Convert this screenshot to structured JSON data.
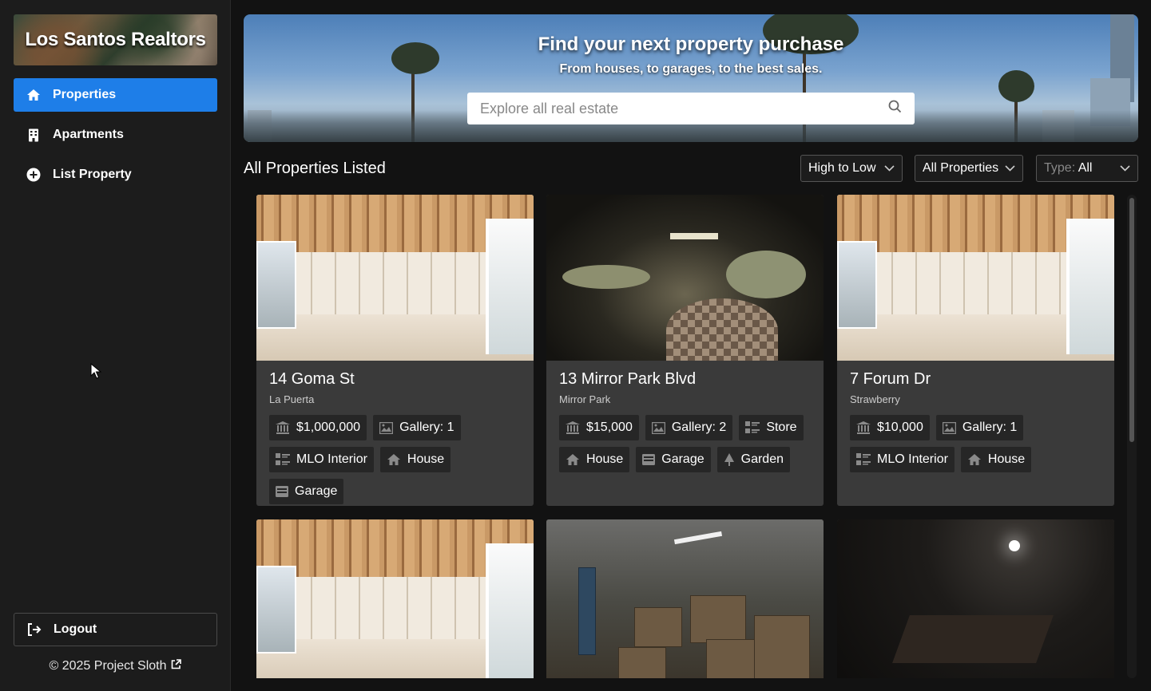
{
  "sidebar": {
    "brand": "Los Santos Realtors",
    "items": [
      {
        "label": "Properties",
        "icon": "home-icon",
        "active": true
      },
      {
        "label": "Apartments",
        "icon": "building-icon",
        "active": false
      },
      {
        "label": "List Property",
        "icon": "plus-circle-icon",
        "active": false
      }
    ],
    "logout_label": "Logout",
    "footer": "© 2025 Project Sloth"
  },
  "hero": {
    "title": "Find your next property purchase",
    "subtitle": "From houses, to garages, to the best sales.",
    "search_placeholder": "Explore all real estate"
  },
  "listing": {
    "section_title": "All Properties Listed",
    "sort_value": "High to Low",
    "filter_value": "All Properties",
    "type_label": "Type:",
    "type_value": "All"
  },
  "cards": [
    {
      "title": "14 Goma St",
      "area": "La Puerta",
      "image": "empty-room",
      "tags": [
        {
          "icon": "bank-icon",
          "label": "$1,000,000"
        },
        {
          "icon": "image-icon",
          "label": "Gallery: 1"
        },
        {
          "icon": "interior-icon",
          "label": "MLO Interior"
        },
        {
          "icon": "house-icon",
          "label": "House"
        },
        {
          "icon": "garage-icon",
          "label": "Garage"
        }
      ]
    },
    {
      "title": "13 Mirror Park Blvd",
      "area": "Mirror Park",
      "image": "dark-room",
      "tags": [
        {
          "icon": "bank-icon",
          "label": "$15,000"
        },
        {
          "icon": "image-icon",
          "label": "Gallery: 2"
        },
        {
          "icon": "interior-icon",
          "label": "Store"
        },
        {
          "icon": "house-icon",
          "label": "House"
        },
        {
          "icon": "garage-icon",
          "label": "Garage"
        },
        {
          "icon": "tree-icon",
          "label": "Garden"
        }
      ]
    },
    {
      "title": "7 Forum Dr",
      "area": "Strawberry",
      "image": "empty-room",
      "tags": [
        {
          "icon": "bank-icon",
          "label": "$10,000"
        },
        {
          "icon": "image-icon",
          "label": "Gallery: 1"
        },
        {
          "icon": "interior-icon",
          "label": "MLO Interior"
        },
        {
          "icon": "house-icon",
          "label": "House"
        }
      ]
    }
  ],
  "colors": {
    "accent": "#1e7ee8",
    "background": "#121212",
    "sidebar": "#1c1c1c",
    "card": "#3a3a3a",
    "tag": "#262626"
  }
}
